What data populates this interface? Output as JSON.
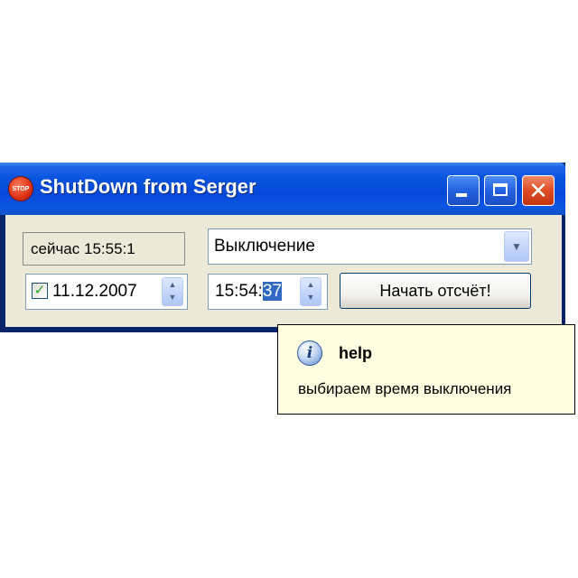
{
  "window": {
    "title": "ShutDown from Serger",
    "icon_name": "stop-sign-icon",
    "icon_text": "STOP",
    "controls": {
      "minimize_icon": "minimize-icon",
      "maximize_icon": "maximize-icon",
      "close_icon": "close-icon",
      "close_glyph": "✕"
    }
  },
  "now": {
    "label": "сейчас 15:55:1"
  },
  "action": {
    "selected": "Выключение"
  },
  "date": {
    "checked": true,
    "check_glyph": "✓",
    "value": "11.12.2007"
  },
  "time": {
    "prefix": "15:54:",
    "selected_part": "37"
  },
  "start_button": {
    "label": "Начать отсчёт!"
  },
  "tooltip": {
    "icon_name": "info-icon",
    "icon_glyph": "i",
    "title": "help",
    "text": "выбираем время выключения"
  },
  "colors": {
    "titlebar": "#0a54e0",
    "client_bg": "#ece9d8",
    "close_button": "#e0502a",
    "selection": "#316ac5",
    "tooltip_bg": "#ffffe1"
  }
}
